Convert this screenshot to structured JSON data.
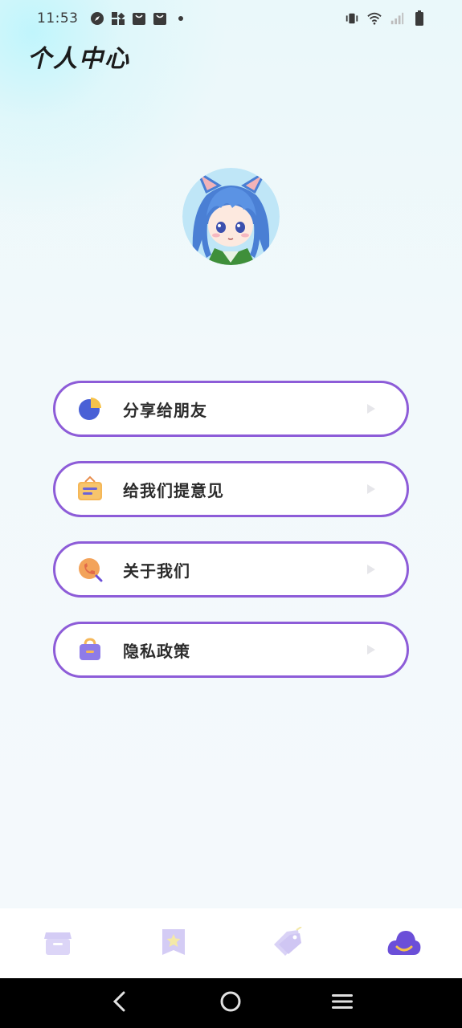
{
  "status_bar": {
    "time": "11:53",
    "left_icons": [
      "compass-icon",
      "grid-icon",
      "bag-icon",
      "bag-icon",
      "dot-icon"
    ],
    "right_icons": [
      "vibrate-icon",
      "wifi-icon",
      "signal-icon",
      "battery-icon"
    ]
  },
  "header": {
    "title": "个人中心"
  },
  "profile": {
    "avatar": "anime-girl-avatar"
  },
  "menu": {
    "items": [
      {
        "label": "分享给朋友",
        "icon": "pie-chart-icon"
      },
      {
        "label": "给我们提意见",
        "icon": "feedback-box-icon"
      },
      {
        "label": "关于我们",
        "icon": "phone-icon"
      },
      {
        "label": "隐私政策",
        "icon": "lock-bag-icon"
      }
    ]
  },
  "tab_bar": {
    "tabs": [
      {
        "icon": "box-icon",
        "active": false
      },
      {
        "icon": "star-card-icon",
        "active": false
      },
      {
        "icon": "tag-icon",
        "active": false
      },
      {
        "icon": "cloud-smile-icon",
        "active": true
      }
    ]
  },
  "colors": {
    "accent": "#8d5cd8",
    "active_tab": "#6b4fd8",
    "inactive_tab": "#d9d2f6"
  },
  "nav_bar": [
    "back-icon",
    "home-icon",
    "menu-icon"
  ]
}
